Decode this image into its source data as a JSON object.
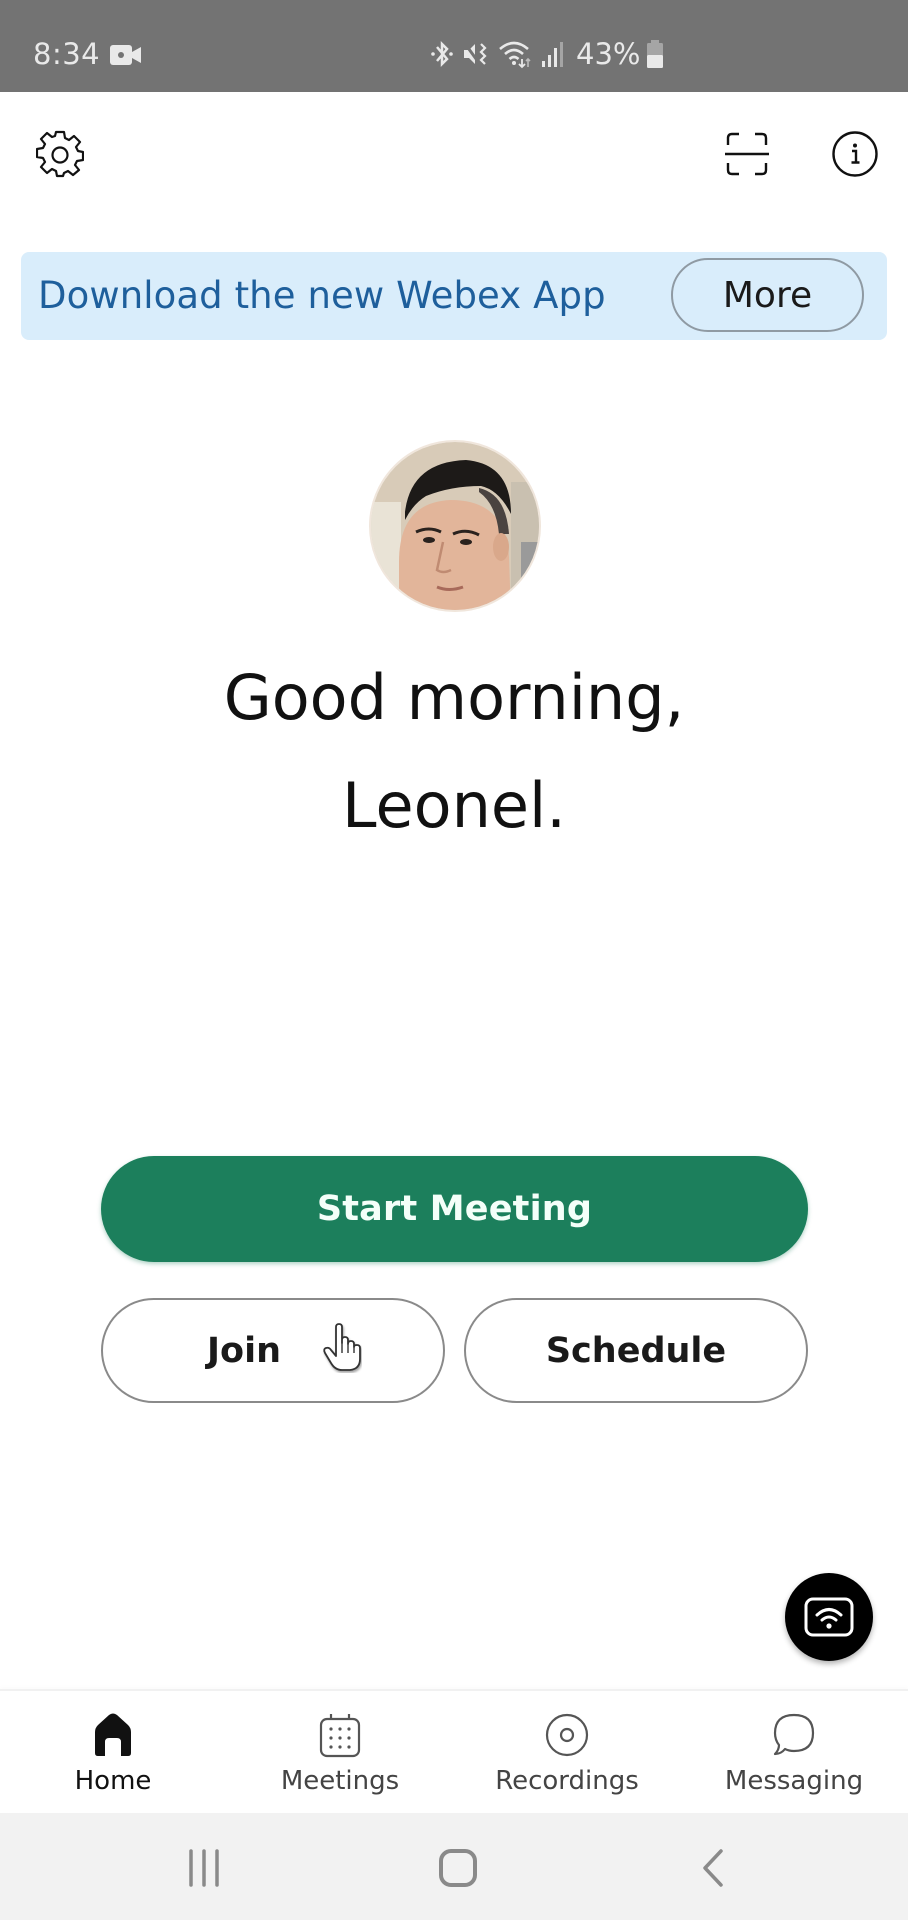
{
  "status_bar": {
    "time": "8:34",
    "battery_percent": "43%",
    "icons": [
      "video-camera-icon",
      "bluetooth-icon",
      "vibrate-icon",
      "wifi-icon",
      "signal-icon",
      "battery-icon"
    ]
  },
  "header": {
    "settings_icon": "gear-icon",
    "scan_icon": "scan-icon",
    "info_icon": "info-icon"
  },
  "banner": {
    "text": "Download the new Webex App",
    "button_label": "More",
    "background": "#d9edfb",
    "text_color": "#1e5f9c"
  },
  "profile": {
    "avatar_alt": "User avatar",
    "greeting_line1": "Good morning,",
    "greeting_line2": "Leonel."
  },
  "actions": {
    "start_meeting": "Start Meeting",
    "join": "Join",
    "schedule": "Schedule",
    "accent_color": "#1c7f5c"
  },
  "fab": {
    "icon": "wireless-share-icon"
  },
  "tabs": [
    {
      "label": "Home",
      "icon": "home-icon",
      "active": true
    },
    {
      "label": "Meetings",
      "icon": "calendar-icon",
      "active": false
    },
    {
      "label": "Recordings",
      "icon": "recording-icon",
      "active": false
    },
    {
      "label": "Messaging",
      "icon": "chat-bubble-icon",
      "active": false
    }
  ],
  "system_nav": {
    "recents": "recents-icon",
    "home": "home-circle-icon",
    "back": "back-icon"
  }
}
